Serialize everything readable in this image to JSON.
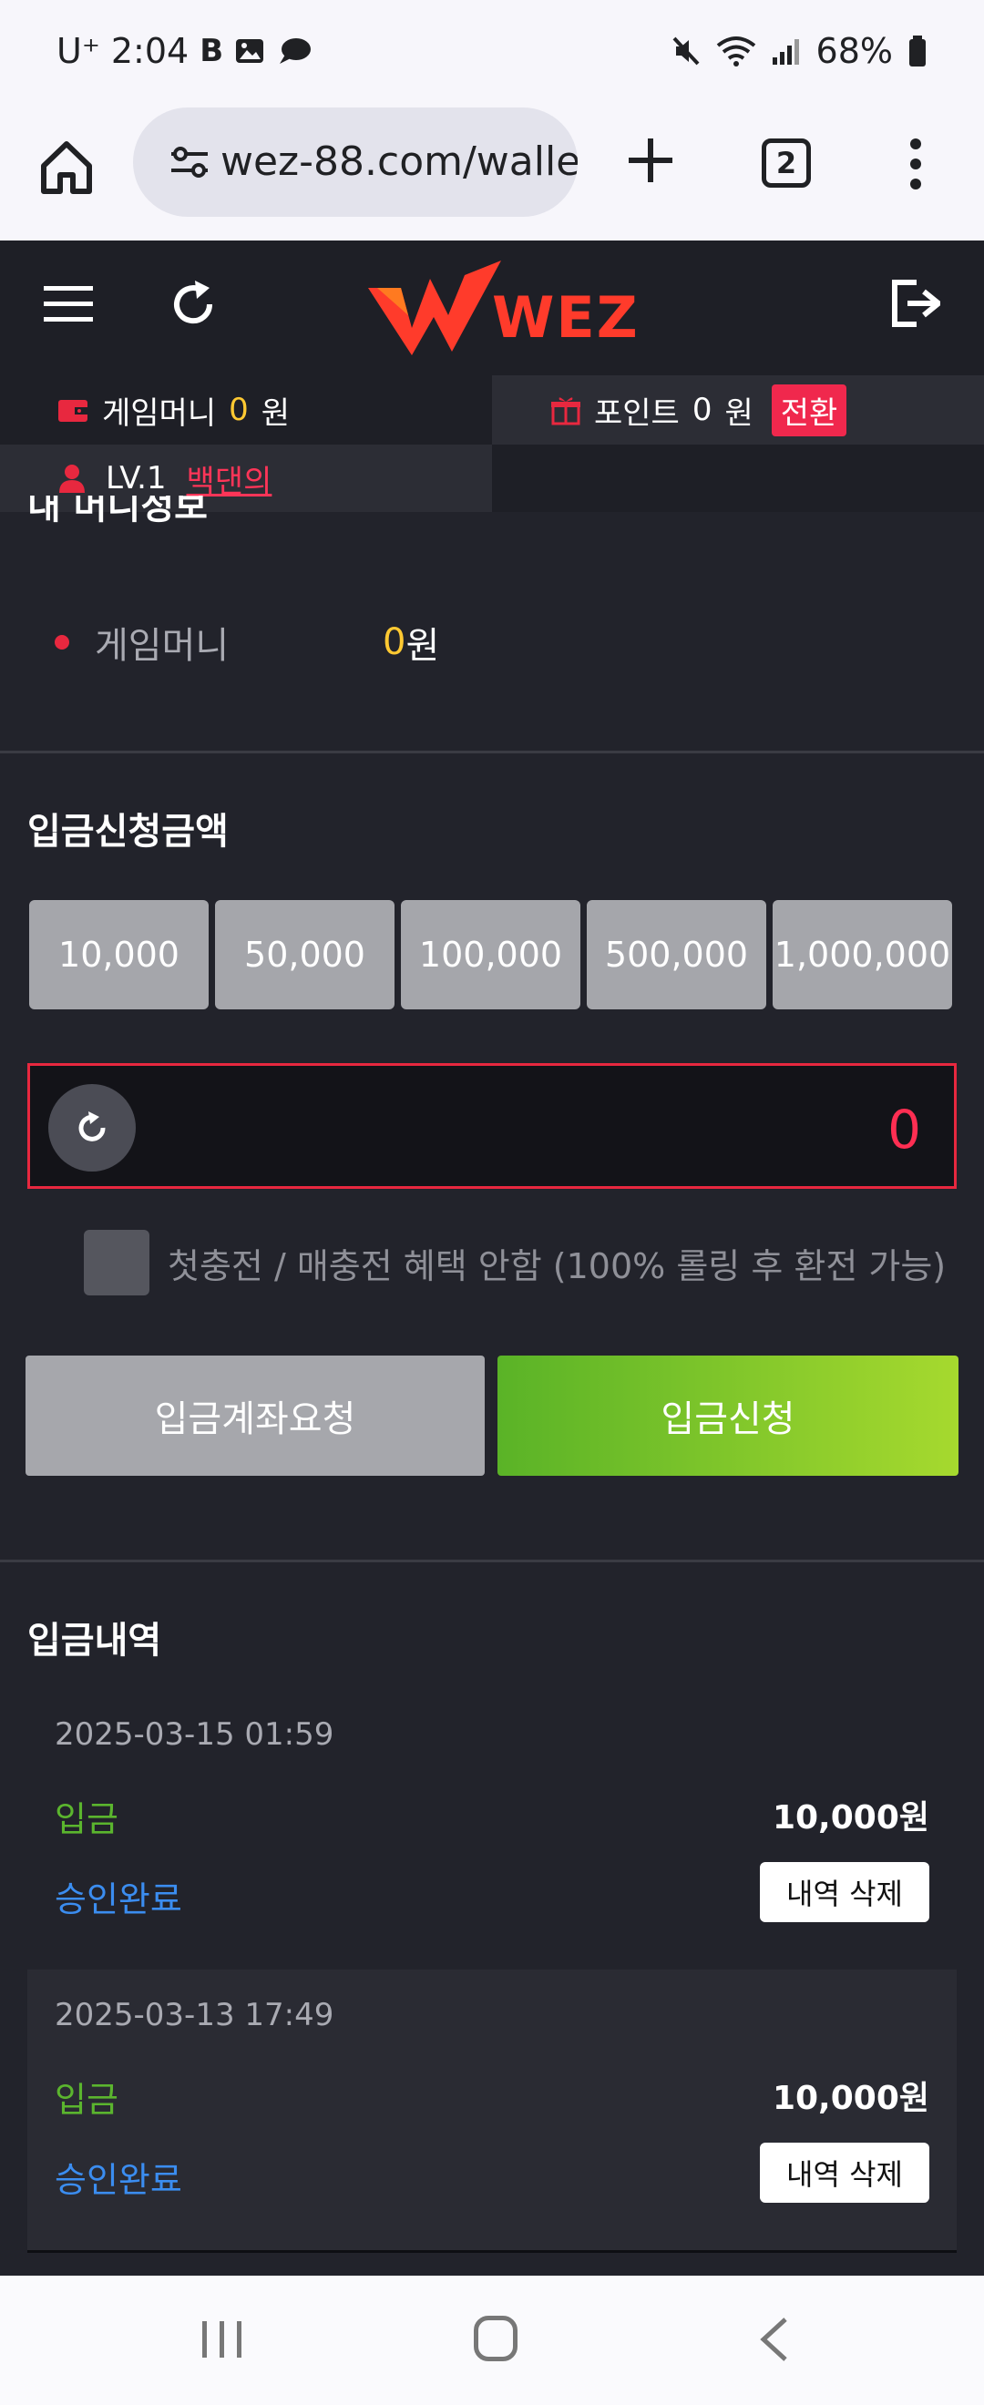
{
  "status_bar": {
    "carrier": "U⁺",
    "time": "2:04",
    "battery": "68%"
  },
  "browser": {
    "url": "wez-88.com/walle",
    "tab_count": "2"
  },
  "header": {
    "logo_text": "WEZ"
  },
  "info_bar": {
    "game_money_label": "게임머니",
    "game_money_value": "0",
    "game_money_unit": "원",
    "point_label": "포인트",
    "point_value": "0",
    "point_unit": "원",
    "convert_label": "전환",
    "level": "LV.1",
    "nickname": "백댄의"
  },
  "my_money": {
    "title_partial": "내 머니정보",
    "label": "게임머니",
    "value": "0",
    "unit": "원"
  },
  "deposit": {
    "title": "입금신청금액",
    "amount_buttons": [
      "10,000",
      "50,000",
      "100,000",
      "500,000",
      "1,000,000"
    ],
    "amount_value": "0",
    "checkbox_label": "첫충전 / 매충전 혜택 안함 (100% 롤링 후 환전 가능)",
    "account_request_label": "입금계좌요청",
    "submit_label": "입금신청"
  },
  "history": {
    "title": "입금내역",
    "items": [
      {
        "date": "2025-03-15 01:59",
        "type": "입금",
        "amount": "10,000원",
        "status": "승인완료",
        "delete_label": "내역 삭제"
      },
      {
        "date": "2025-03-13 17:49",
        "type": "입금",
        "amount": "10,000원",
        "status": "승인완료",
        "delete_label": "내역 삭제"
      }
    ]
  },
  "colors": {
    "accent_red": "#e8283f",
    "money_yellow": "#ffc932",
    "green": "#5bb52e",
    "blue": "#3b8df0"
  }
}
